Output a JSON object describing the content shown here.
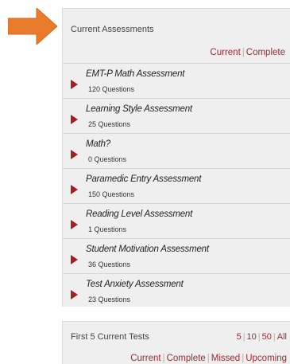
{
  "assessments_panel": {
    "title": "Current Assessments",
    "filters": [
      "Current",
      "Complete"
    ],
    "items": [
      {
        "name": "EMT-P Math Assessment",
        "count": "120 Questions"
      },
      {
        "name": "Learning Style Assessment",
        "count": "25 Questions"
      },
      {
        "name": "Math?",
        "count": "0 Questions"
      },
      {
        "name": "Paramedic Entry Assessment",
        "count": "150 Questions"
      },
      {
        "name": "Reading Level Assessment",
        "count": "1 Questions"
      },
      {
        "name": "Student Motivation Assessment",
        "count": "36 Questions"
      },
      {
        "name": "Test Anxiety Assessment",
        "count": "23 Questions"
      }
    ]
  },
  "tests_panel": {
    "title": "First 5 Current Tests",
    "page_sizes": [
      "5",
      "10",
      "50",
      "All"
    ],
    "filters": [
      "Current",
      "Complete",
      "Missed",
      "Upcoming"
    ]
  },
  "colors": {
    "arrow": "#e87b2c",
    "link": "#a0282b",
    "play_icon": "#a51f22",
    "panel_bg": "#efefef"
  },
  "icons": {
    "pointer": "arrow-right-icon",
    "item": "play-icon"
  }
}
